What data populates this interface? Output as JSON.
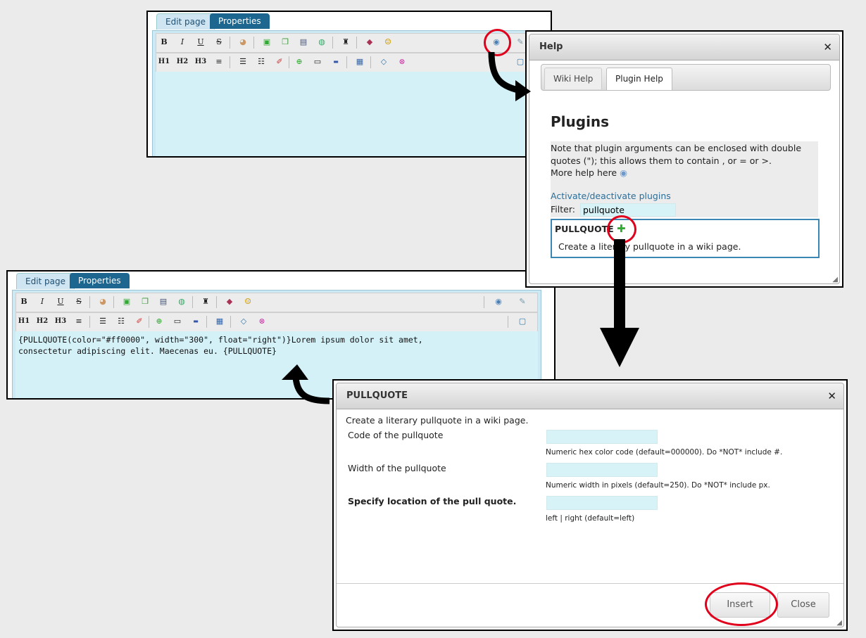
{
  "editor": {
    "tab_edit": "Edit page",
    "tab_properties": "Properties",
    "toolbar_row1": [
      "B",
      "I",
      "U",
      "S"
    ],
    "toolbar_row2": [
      "H1",
      "H2",
      "H3"
    ],
    "content": "{PULLQUOTE(color=\"#ff0000\", width=\"300\", float=\"right\")}Lorem ipsum dolor sit amet,\nconsectetur adipiscing elit. Maecenas eu. {PULLQUOTE}"
  },
  "help_dialog": {
    "title": "Help",
    "tabs": [
      "Wiki Help",
      "Plugin Help"
    ],
    "heading": "Plugins",
    "note": "Note that plugin arguments can be enclosed with double quotes (\"); this allows them to contain , or = or >.",
    "more_help": "More help here",
    "activate_link": "Activate/deactivate plugins",
    "filter_label": "Filter:",
    "filter_value": "pullquote",
    "plugin_name": "PULLQUOTE",
    "plugin_desc": "Create a literary pullquote in a wiki page."
  },
  "pullquote_dialog": {
    "title": "PULLQUOTE",
    "description": "Create a literary pullquote in a wiki page.",
    "fields": [
      {
        "label": "Code of the pullquote",
        "hint": "Numeric hex color code (default=000000). Do *NOT* include #.",
        "value": ""
      },
      {
        "label": "Width of the pullquote",
        "hint": "Numeric width in pixels (default=250). Do *NOT* include px.",
        "value": ""
      },
      {
        "label": "Specify location of the pull quote.",
        "hint": "left | right (default=left)",
        "value": ""
      }
    ],
    "insert_label": "Insert",
    "close_label": "Close"
  },
  "colors": {
    "tab_active_bg": "#cfe6f2",
    "tab_inactive_bg": "#1d6690",
    "editor_bg": "#d4f1f8",
    "highlight_red": "#e0001b",
    "link": "#2a6e9a"
  }
}
